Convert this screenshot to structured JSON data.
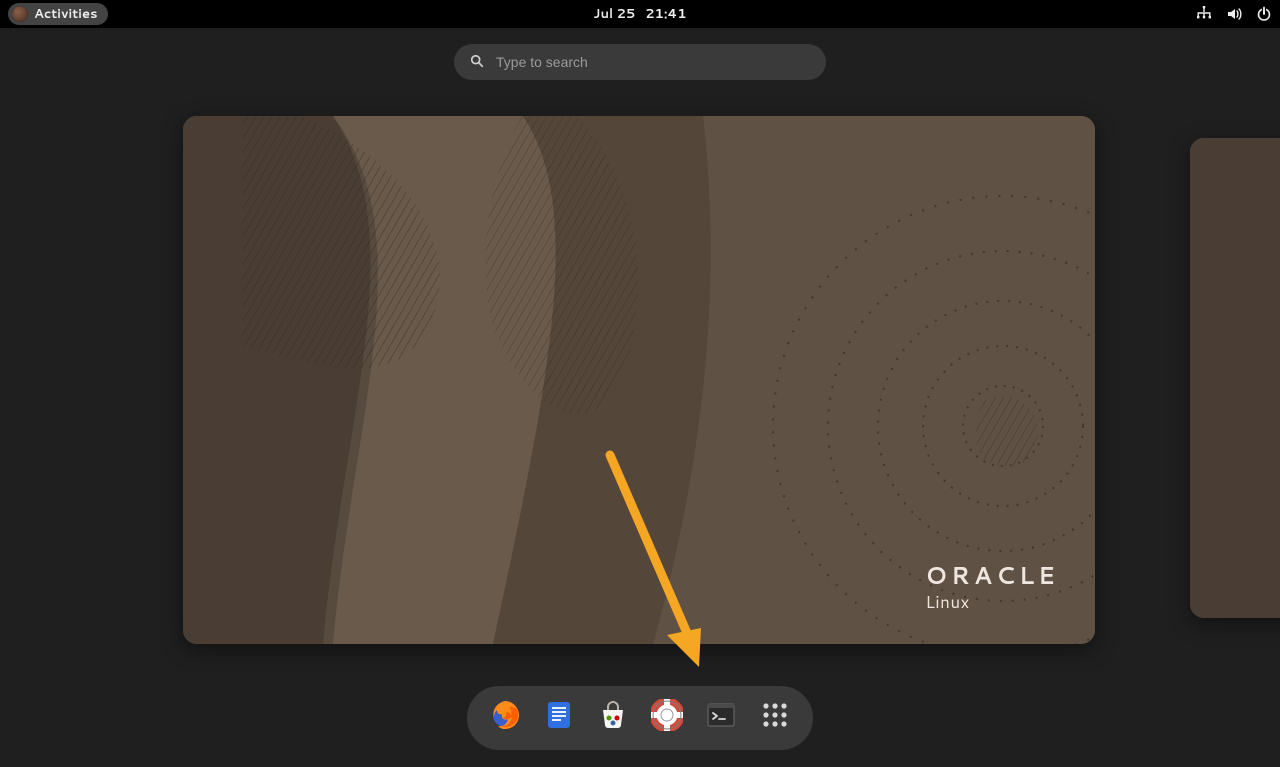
{
  "topbar": {
    "activities_label": "Activities",
    "date": "Jul 25",
    "time": "21:41"
  },
  "search": {
    "placeholder": "Type to search",
    "value": ""
  },
  "workspace": {
    "brand_top": "ORACLE",
    "brand_bottom": "Linux"
  },
  "dock": {
    "items": [
      {
        "name": "firefox-icon"
      },
      {
        "name": "text-editor-icon"
      },
      {
        "name": "software-center-icon"
      },
      {
        "name": "help-icon"
      },
      {
        "name": "terminal-icon"
      },
      {
        "name": "apps-grid-icon"
      }
    ]
  }
}
